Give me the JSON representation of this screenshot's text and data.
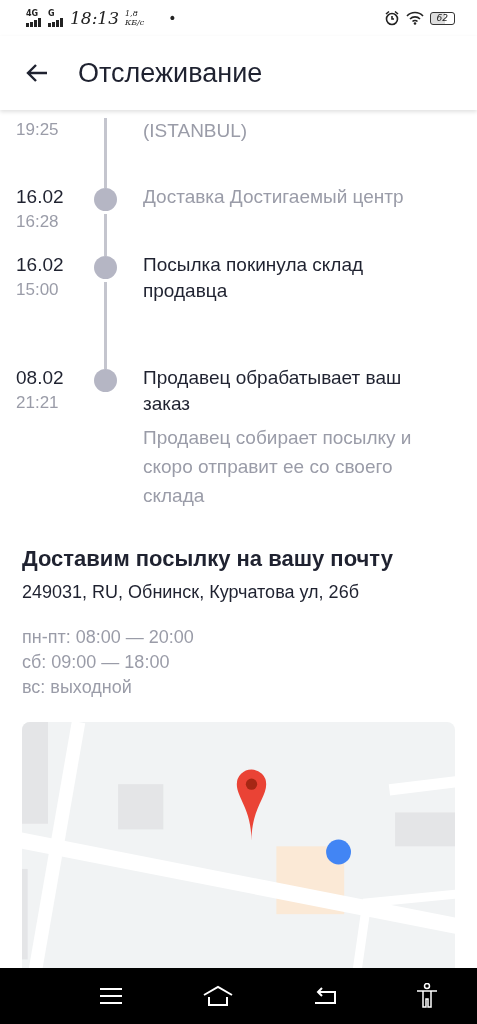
{
  "status_bar": {
    "network_1": "4G",
    "network_2": "G",
    "time": "18:13",
    "speed": "1,8",
    "speed_unit": "КБ/с",
    "dot": "•",
    "battery": "62"
  },
  "header": {
    "title": "Отслеживание"
  },
  "events": [
    {
      "time": "19:25",
      "title": "(ISTANBUL)",
      "muted": true,
      "dot": false
    },
    {
      "date": "16.02",
      "time": "16:28",
      "title": "Доставка Достигаемый центр",
      "muted": true,
      "dot": true
    },
    {
      "date": "16.02",
      "time": "15:00",
      "title": "Посылка покинула склад продавца",
      "muted": false,
      "dot": true
    },
    {
      "date": "08.02",
      "time": "21:21",
      "title": "Продавец обрабатывает ваш заказ",
      "description": "Продавец собирает посылку и скоро отправит ее со своего склада",
      "muted": false,
      "dot": true
    }
  ],
  "delivery": {
    "title": "Доставим посылку на вашу почту",
    "address": "249031, RU, Обнинск, Курчатова ул, 26б",
    "hours": [
      "пн-пт: 08:00 — 20:00",
      "сб: 09:00 — 18:00",
      "вс: выходной"
    ],
    "map": {
      "kind": "picture"
    }
  }
}
